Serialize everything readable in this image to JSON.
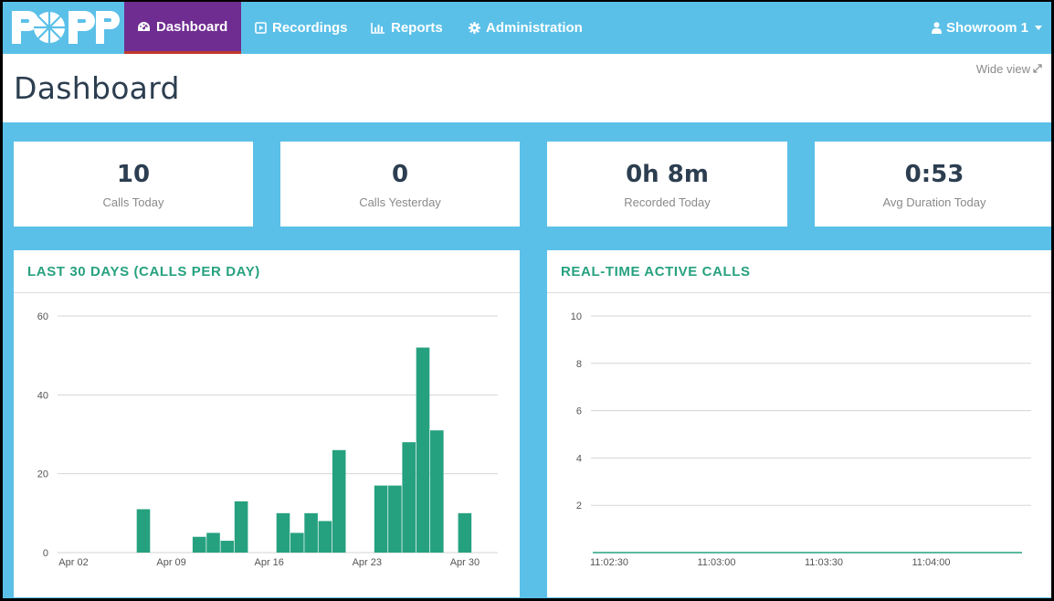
{
  "brand": {
    "logo_text": "POPP"
  },
  "nav": {
    "items": [
      {
        "label": "Dashboard",
        "icon": "tachometer-icon",
        "active": true
      },
      {
        "label": "Recordings",
        "icon": "play-square-icon",
        "active": false
      },
      {
        "label": "Reports",
        "icon": "bar-chart-icon",
        "active": false
      },
      {
        "label": "Administration",
        "icon": "gear-icon",
        "active": false
      }
    ],
    "user": {
      "label": "Showroom 1",
      "icon": "user-icon"
    }
  },
  "page": {
    "title": "Dashboard",
    "wide_view": "Wide view"
  },
  "stats": [
    {
      "value": "10",
      "label": "Calls Today"
    },
    {
      "value": "0",
      "label": "Calls Yesterday"
    },
    {
      "value": "0h 8m",
      "label": "Recorded Today"
    },
    {
      "value": "0:53",
      "label": "Avg Duration Today"
    }
  ],
  "colors": {
    "nav_bg": "#5bc0e8",
    "nav_active": "#6f2c91",
    "bar": "#26a17f",
    "title": "#26a17f"
  },
  "chart_data": [
    {
      "type": "bar",
      "title": "LAST 30 DAYS (CALLS PER DAY)",
      "x_ticks": [
        "Apr 02",
        "Apr 09",
        "Apr 16",
        "Apr 23",
        "Apr 30"
      ],
      "y_ticks": [
        0,
        20,
        40,
        60
      ],
      "ylim": [
        0,
        60
      ],
      "x": [
        "Apr 01",
        "Apr 02",
        "Apr 03",
        "Apr 04",
        "Apr 05",
        "Apr 06",
        "Apr 07",
        "Apr 08",
        "Apr 09",
        "Apr 10",
        "Apr 11",
        "Apr 12",
        "Apr 13",
        "Apr 14",
        "Apr 15",
        "Apr 16",
        "Apr 17",
        "Apr 18",
        "Apr 19",
        "Apr 20",
        "Apr 21",
        "Apr 22",
        "Apr 23",
        "Apr 24",
        "Apr 25",
        "Apr 26",
        "Apr 27",
        "Apr 28",
        "Apr 29",
        "Apr 30"
      ],
      "values": [
        0,
        0,
        0,
        0,
        0,
        0,
        11,
        0,
        0,
        0,
        4,
        5,
        3,
        13,
        0,
        0,
        10,
        5,
        10,
        8,
        26,
        0,
        0,
        17,
        17,
        28,
        52,
        31,
        0,
        10
      ],
      "grid": true
    },
    {
      "type": "line",
      "title": "REAL-TIME ACTIVE CALLS",
      "x_ticks": [
        "11:02:30",
        "11:03:00",
        "11:03:30",
        "11:04:00"
      ],
      "y_ticks": [
        2,
        4,
        6,
        8,
        10
      ],
      "ylim": [
        0,
        10
      ],
      "x": [
        "11:02:30",
        "11:03:00",
        "11:03:30",
        "11:04:00",
        "11:04:30"
      ],
      "values": [
        0,
        0,
        0,
        0,
        0
      ],
      "grid": true
    }
  ]
}
